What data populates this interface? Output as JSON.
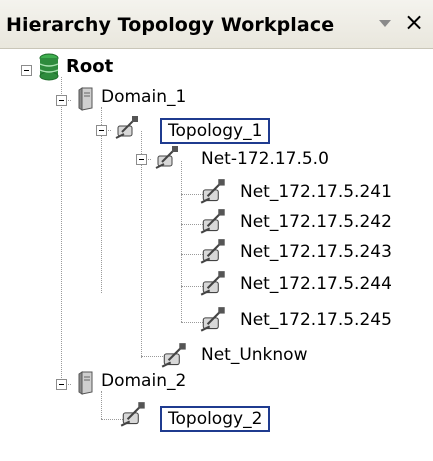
{
  "panel": {
    "title": "Hierarchy Topology Workplace",
    "dropdown_icon": "dropdown-arrow-icon",
    "close_icon": "close-icon",
    "close_glyph": "×"
  },
  "tree": {
    "root": {
      "label": "Root",
      "icon": "database-icon"
    },
    "domain1": {
      "label": "Domain_1",
      "icon": "server-icon"
    },
    "topology1": {
      "label": "Topology_1",
      "icon": "network-node-icon"
    },
    "net": {
      "label": "Net-172.17.5.0",
      "icon": "network-node-icon"
    },
    "net_children": [
      {
        "label": "Net_172.17.5.241",
        "icon": "network-node-icon"
      },
      {
        "label": "Net_172.17.5.242",
        "icon": "network-node-icon"
      },
      {
        "label": "Net_172.17.5.243",
        "icon": "network-node-icon"
      },
      {
        "label": "Net_172.17.5.244",
        "icon": "network-node-icon"
      },
      {
        "label": "Net_172.17.5.245",
        "icon": "network-node-icon"
      }
    ],
    "unknow": {
      "label": "Net_Unknow",
      "icon": "network-node-icon"
    },
    "domain2": {
      "label": "Domain_2",
      "icon": "server-icon"
    },
    "topology2": {
      "label": "Topology_2",
      "icon": "network-node-icon"
    }
  },
  "colors": {
    "highlight_border": "#1f3b8f",
    "database_green": "#2e8b3d",
    "server_gray": "#9a9a9a"
  }
}
